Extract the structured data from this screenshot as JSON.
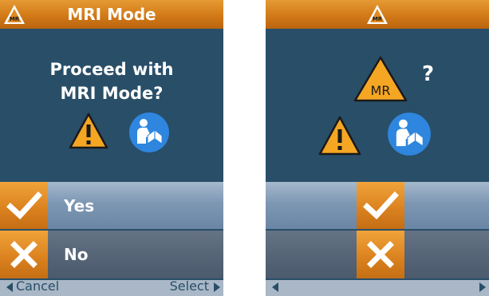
{
  "left_screen": {
    "header": {
      "title": "MRI Mode",
      "mr_icon_label": "MR"
    },
    "prompt": {
      "line1": "Proceed with",
      "line2": "MRI Mode?"
    },
    "options": {
      "yes": {
        "label": "Yes",
        "icon": "check-icon"
      },
      "no": {
        "label": "No",
        "icon": "x-icon"
      }
    },
    "footer": {
      "left": "Cancel",
      "right": "Select"
    }
  },
  "right_screen": {
    "header": {
      "mr_icon_label": "MR"
    },
    "mr_symbol_label": "MR",
    "question_mark": "?",
    "options": {
      "yes": {
        "icon": "check-icon"
      },
      "no": {
        "icon": "x-icon"
      }
    }
  },
  "colors": {
    "screen_bg": "#294E68",
    "accent_orange": "#E08A22",
    "warning_yellow": "#F5A623",
    "manual_blue": "#2E86DE"
  }
}
